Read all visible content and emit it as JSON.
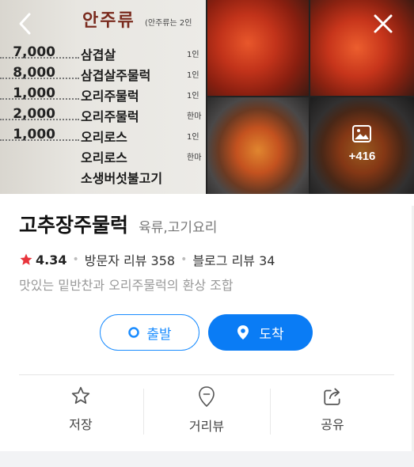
{
  "menu_photo": {
    "heading": "안주류",
    "subheading": "(안주류는 2인",
    "rows": [
      {
        "price": "7,000",
        "item": "삼겹살",
        "note": "1인"
      },
      {
        "price": "8,000",
        "item": "삼겹살주물럭",
        "note": "1인"
      },
      {
        "price": "1,000",
        "item": "오리주물럭",
        "note": "1인"
      },
      {
        "price": "2,000",
        "item": "오리주물럭",
        "note": "한마"
      },
      {
        "price": "1,000",
        "item": "오리로스",
        "note": "1인"
      },
      {
        "price": "",
        "item": "오리로스",
        "note": "한마"
      },
      {
        "price": "",
        "item": "소생버섯불고기",
        "note": ""
      }
    ]
  },
  "photos": {
    "more_count": "+416"
  },
  "place": {
    "name": "고추장주물럭",
    "category": "육류,고기요리",
    "rating": "4.34",
    "visitor_reviews": "방문자 리뷰 358",
    "blog_reviews": "블로그 리뷰 34",
    "description": "맛있는 밑반찬과 오리주물럭의 환상 조합"
  },
  "buttons": {
    "start": "출발",
    "arrive": "도착"
  },
  "actions": {
    "save": "저장",
    "roadview": "거리뷰",
    "share": "공유"
  },
  "colors": {
    "accent": "#0a7cf5",
    "star": "#e8343c"
  }
}
